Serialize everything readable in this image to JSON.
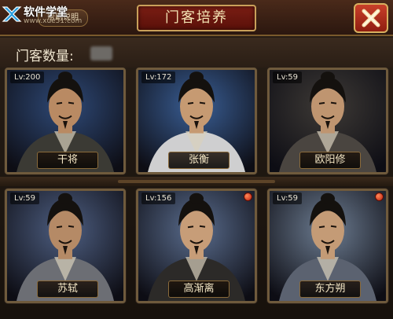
{
  "watermark": {
    "text": "软件学堂",
    "sub": "www.xue51.com"
  },
  "header": {
    "help_label": "帮助说明",
    "title": "门客培养"
  },
  "count": {
    "label": "门客数量:"
  },
  "icons": {
    "close": "close-x-icon",
    "logo": "watermark-logo-icon"
  },
  "colors": {
    "title_plate": "#7a1e14",
    "close_button": "#c9402a",
    "frame_gold": "#c9a05a"
  },
  "cards": [
    {
      "level": "Lv:200",
      "name": "干将",
      "bg": "#2f4a78",
      "robe": "#3b3a34",
      "skin": "#b98a63",
      "has_notice": false
    },
    {
      "level": "Lv:172",
      "name": "张衡",
      "bg": "#3a5f96",
      "robe": "#cfcfd0",
      "skin": "#c69a72",
      "has_notice": false
    },
    {
      "level": "Lv:59",
      "name": "欧阳修",
      "bg": "#3e3a36",
      "robe": "#4a4540",
      "skin": "#bf9570",
      "has_notice": false
    },
    {
      "level": "Lv:59",
      "name": "苏轼",
      "bg": "#4e5f82",
      "robe": "#6c6e74",
      "skin": "#b58a66",
      "has_notice": false
    },
    {
      "level": "Lv:156",
      "name": "高渐离",
      "bg": "#5a6d8e",
      "robe": "#2c2a28",
      "skin": "#c79d78",
      "has_notice": true
    },
    {
      "level": "Lv:59",
      "name": "东方朔",
      "bg": "#6d7d92",
      "robe": "#5b6270",
      "skin": "#c49b76",
      "has_notice": true
    }
  ]
}
